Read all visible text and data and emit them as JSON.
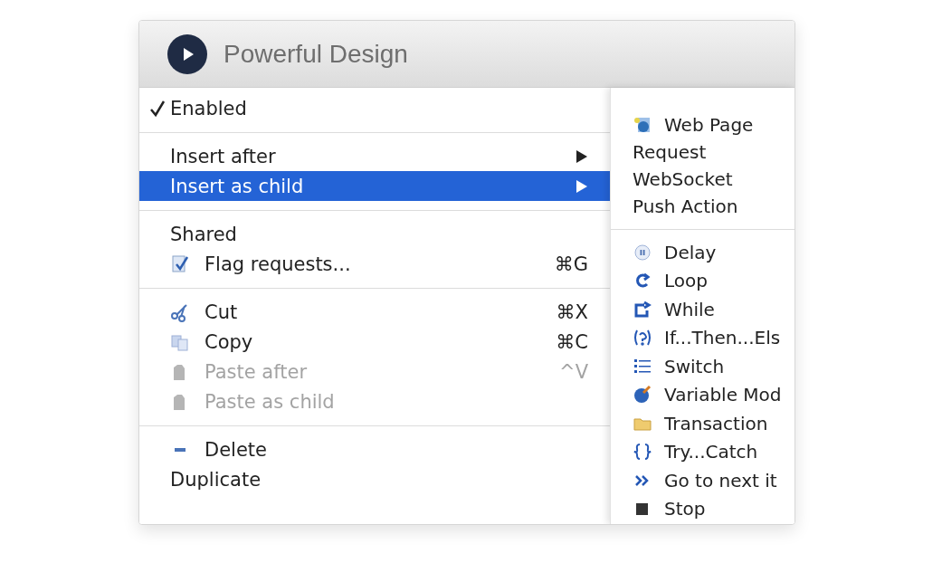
{
  "window": {
    "title": "Powerful Design"
  },
  "menu": {
    "sections": [
      [
        {
          "label": "Enabled",
          "checked": true,
          "selected": false,
          "disabled": false,
          "submenu": false
        }
      ],
      [
        {
          "label": "Insert after",
          "checked": false,
          "selected": false,
          "disabled": false,
          "submenu": true
        },
        {
          "label": "Insert as child",
          "checked": false,
          "selected": true,
          "disabled": false,
          "submenu": true
        }
      ],
      [
        {
          "label": "Shared",
          "checked": false,
          "selected": false,
          "disabled": false,
          "submenu": false
        },
        {
          "label": "Flag requests...",
          "shortcut": "⌘G",
          "checked": false,
          "selected": false,
          "disabled": false,
          "submenu": false
        }
      ],
      [
        {
          "label": "Cut",
          "shortcut": "⌘X",
          "checked": false,
          "selected": false,
          "disabled": false,
          "submenu": false
        },
        {
          "label": "Copy",
          "shortcut": "⌘C",
          "checked": false,
          "selected": false,
          "disabled": false,
          "submenu": false
        },
        {
          "label": "Paste after",
          "shortcut": "^V",
          "checked": false,
          "selected": false,
          "disabled": true,
          "submenu": false
        },
        {
          "label": "Paste as child",
          "checked": false,
          "selected": false,
          "disabled": true,
          "submenu": false
        }
      ],
      [
        {
          "label": "Delete",
          "checked": false,
          "selected": false,
          "disabled": false,
          "submenu": false
        },
        {
          "label": "Duplicate",
          "checked": false,
          "selected": false,
          "disabled": false,
          "submenu": false
        }
      ]
    ]
  },
  "submenu": {
    "sections": [
      [
        {
          "label": "Web Page"
        },
        {
          "label": "Request"
        },
        {
          "label": "WebSocket"
        },
        {
          "label": "Push Action"
        }
      ],
      [
        {
          "label": "Delay"
        },
        {
          "label": "Loop"
        },
        {
          "label": "While"
        },
        {
          "label": "If...Then...Els"
        },
        {
          "label": "Switch"
        },
        {
          "label": "Variable Mod"
        },
        {
          "label": "Transaction"
        },
        {
          "label": "Try...Catch"
        },
        {
          "label": "Go to next it"
        },
        {
          "label": "Stop"
        }
      ]
    ]
  }
}
